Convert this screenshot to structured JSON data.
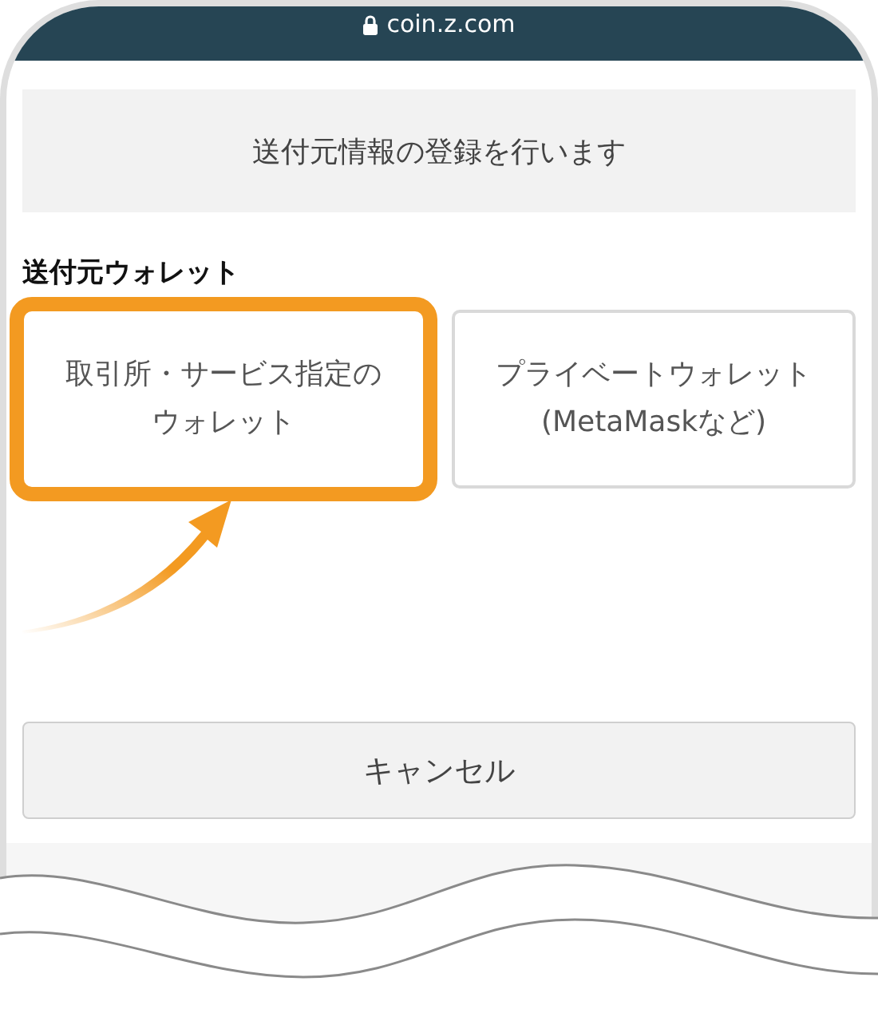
{
  "address_bar": {
    "url": "coin.z.com"
  },
  "notice": "送付元情報の登録を行います",
  "section_label": "送付元ウォレット",
  "options": [
    {
      "lines": [
        "取引所・サービス指定の",
        "ウォレット"
      ],
      "highlighted": true
    },
    {
      "lines": [
        "プライベートウォレット",
        "(MetaMaskなど)"
      ],
      "highlighted": false
    }
  ],
  "cancel_button": "キャンセル"
}
